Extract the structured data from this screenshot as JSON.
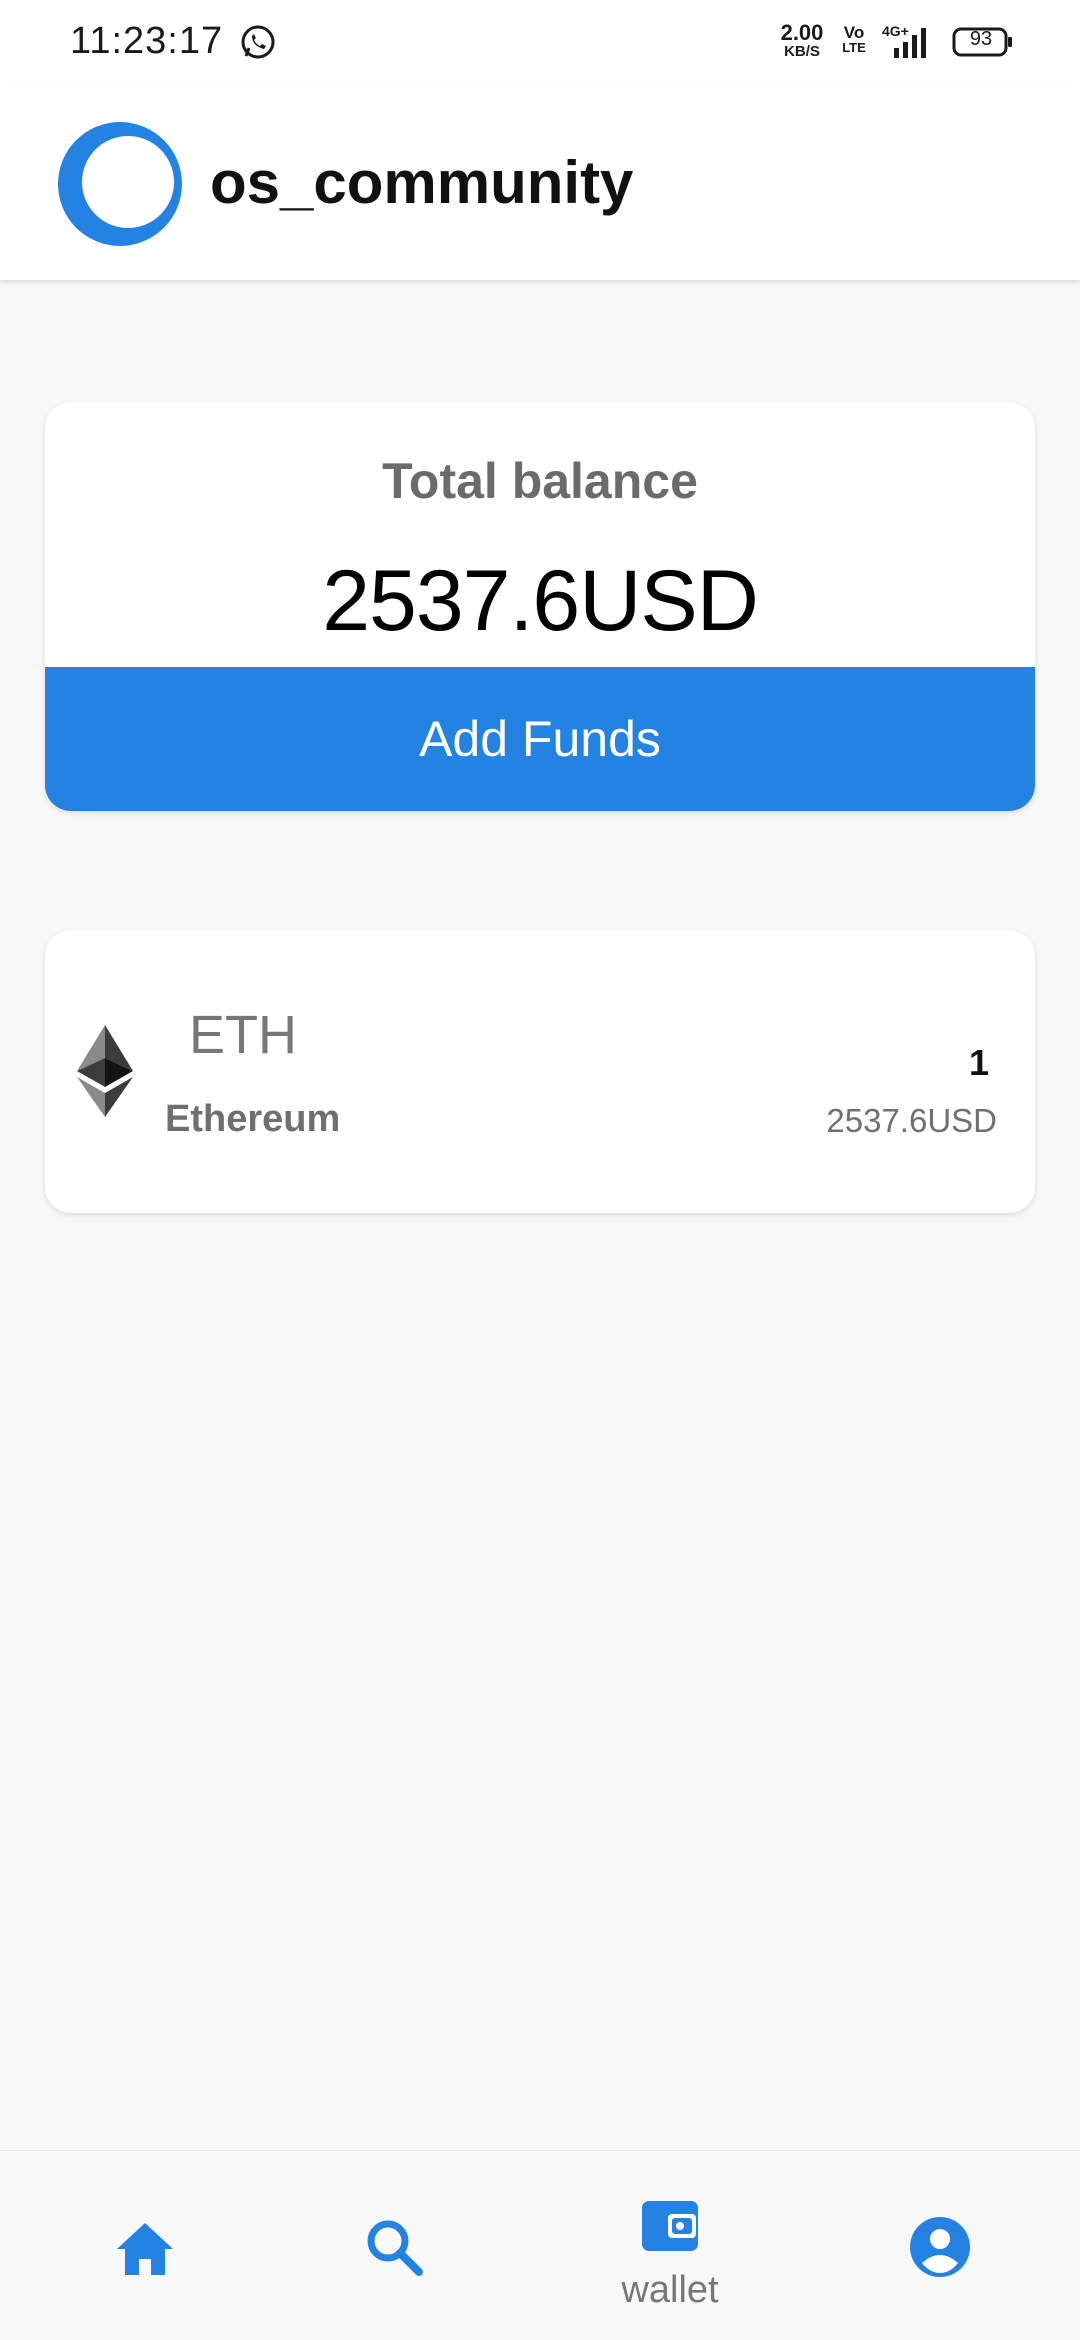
{
  "status_bar": {
    "time": "11:23:17",
    "net_speed_value": "2.00",
    "net_speed_unit": "KB/S",
    "volte_top": "Vo",
    "volte_bottom": "LTE",
    "network": "4G+",
    "battery": "93"
  },
  "header": {
    "app_title": "os_community"
  },
  "balance_card": {
    "label": "Total balance",
    "value": "2537.6USD",
    "add_funds_label": "Add Funds"
  },
  "assets": [
    {
      "symbol": "ETH",
      "name": "Ethereum",
      "amount": "1",
      "usd_value": "2537.6USD",
      "icon": "ethereum-icon"
    }
  ],
  "bottom_nav": {
    "items": [
      {
        "icon": "home-icon",
        "label": ""
      },
      {
        "icon": "search-icon",
        "label": ""
      },
      {
        "icon": "wallet-icon",
        "label": "wallet"
      },
      {
        "icon": "account-icon",
        "label": ""
      }
    ],
    "active": "wallet"
  },
  "colors": {
    "accent": "#2482e3",
    "background": "#f8f8f8",
    "card": "#ffffff"
  }
}
